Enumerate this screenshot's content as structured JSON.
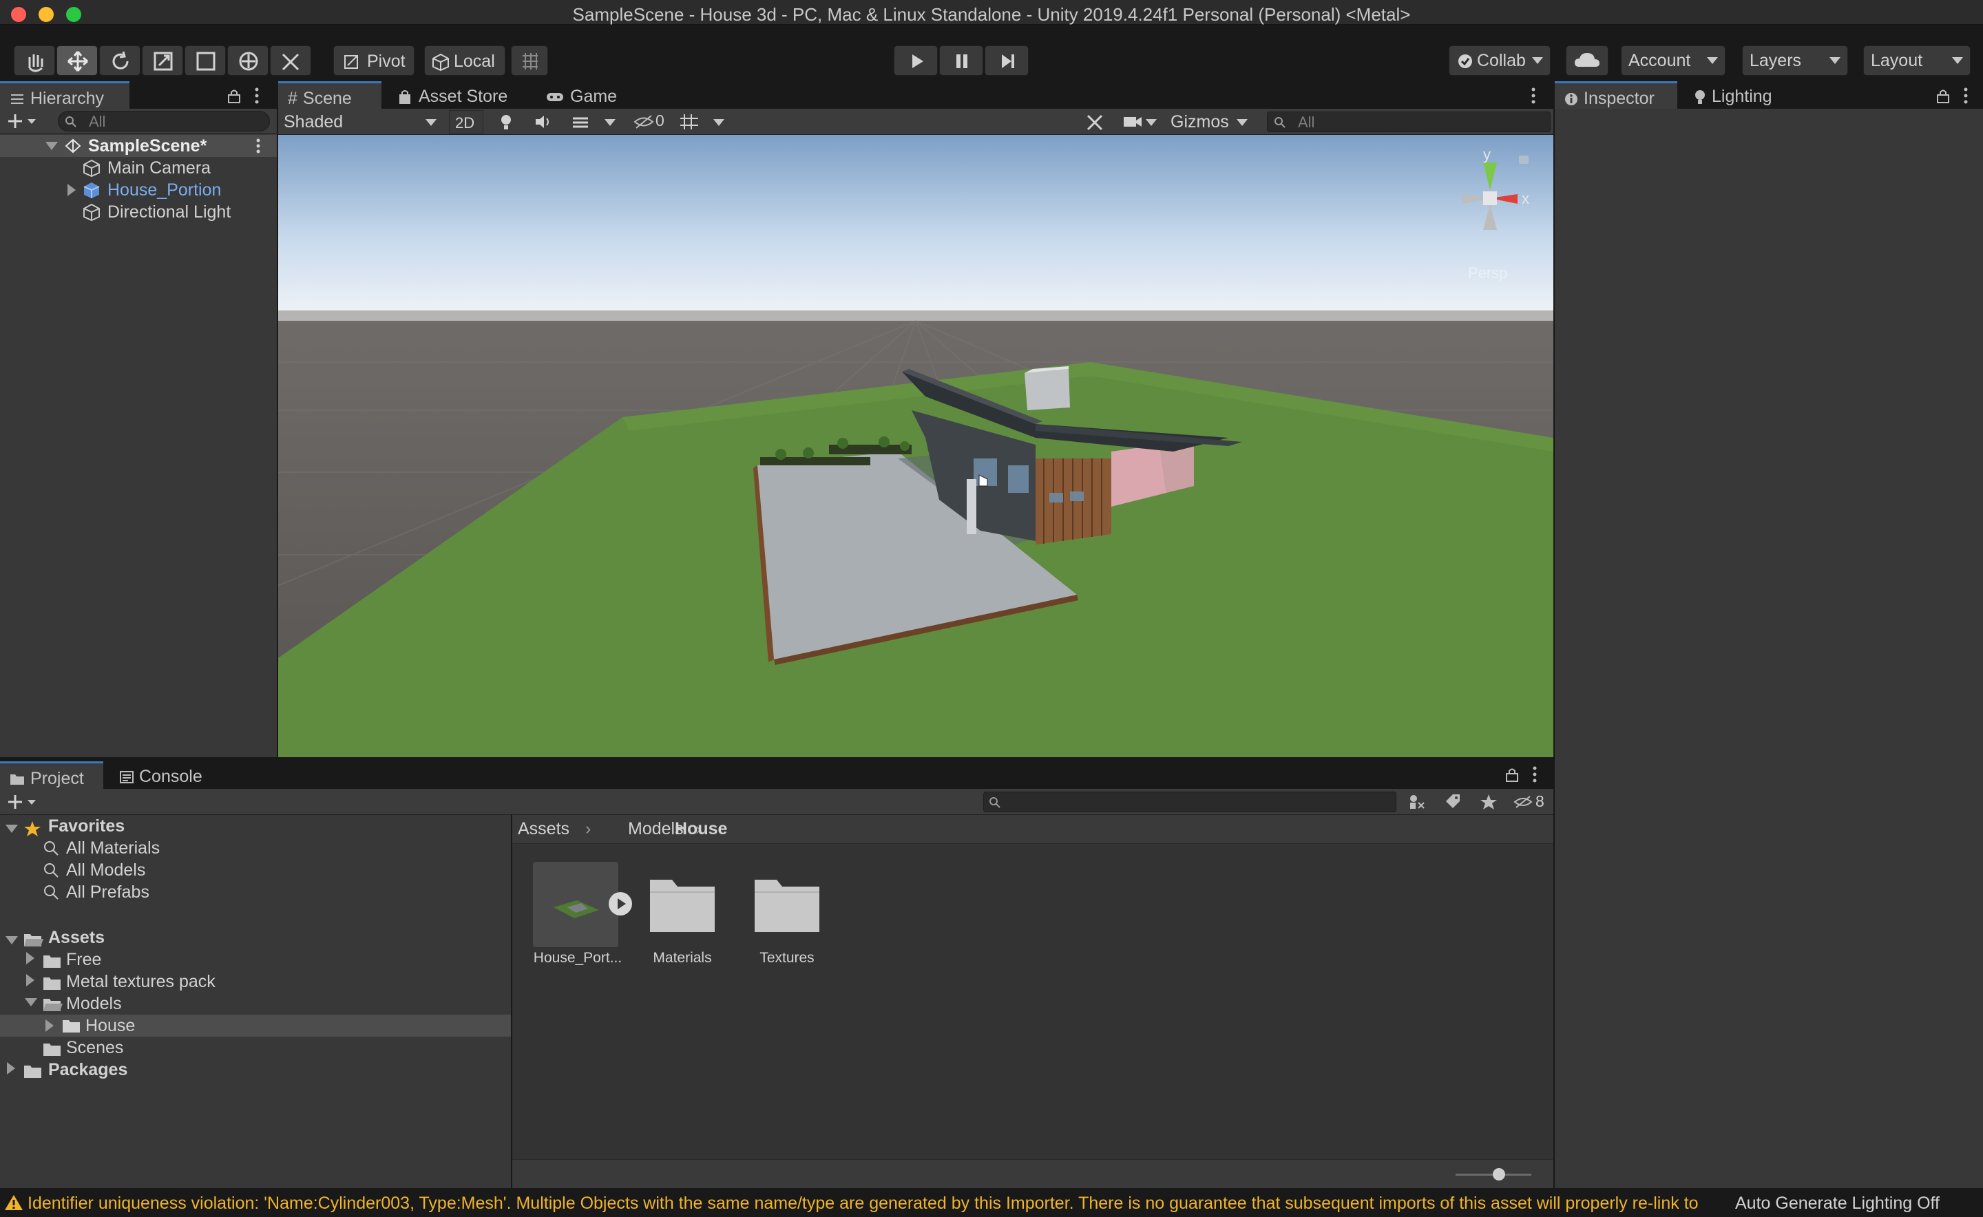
{
  "window": {
    "title": "SampleScene - House 3d - PC, Mac & Linux Standalone - Unity 2019.4.24f1 Personal (Personal) <Metal>"
  },
  "toolbar": {
    "pivot_label": "Pivot",
    "local_label": "Local",
    "collab_label": "Collab",
    "account_label": "Account",
    "layers_label": "Layers",
    "layout_label": "Layout"
  },
  "hierarchy": {
    "tab_label": "Hierarchy",
    "search_placeholder": "All",
    "scene_name": "SampleScene*",
    "items": [
      "Main Camera",
      "House_Portion",
      "Directional Light"
    ]
  },
  "scene_view": {
    "tabs": [
      "Scene",
      "Asset Store",
      "Game"
    ],
    "shading_mode": "Shaded",
    "mode_2d": "2D",
    "hidden_count": "0",
    "gizmos_label": "Gizmos",
    "search_placeholder": "All",
    "axis_y": "y",
    "axis_x": "x",
    "projection": "Persp"
  },
  "inspector": {
    "tabs": [
      "Inspector",
      "Lighting"
    ]
  },
  "project": {
    "tabs": [
      "Project",
      "Console"
    ],
    "hidden_packages_count": "8",
    "favorites_label": "Favorites",
    "favorites": [
      "All Materials",
      "All Models",
      "All Prefabs"
    ],
    "assets_label": "Assets",
    "asset_tree": [
      "Free",
      "Metal textures pack",
      "Models",
      "House",
      "Scenes"
    ],
    "packages_label": "Packages",
    "breadcrumb": [
      "Assets",
      "Models",
      "House"
    ],
    "grid_items": [
      "House_Port...",
      "Materials",
      "Textures"
    ]
  },
  "statusbar": {
    "message": "Identifier uniqueness violation: 'Name:Cylinder003, Type:Mesh'. Multiple Objects with the same name/type are generated by this Importer. There is no guarantee that subsequent imports of this asset will properly re-link to",
    "lighting": "Auto Generate Lighting Off"
  },
  "colors": {
    "selected_blue": "#7bacee",
    "accent_tab": "#3a79bb",
    "warning": "#f0b429",
    "grass": "#5f8c3e",
    "sky": "#8fb2d8"
  }
}
